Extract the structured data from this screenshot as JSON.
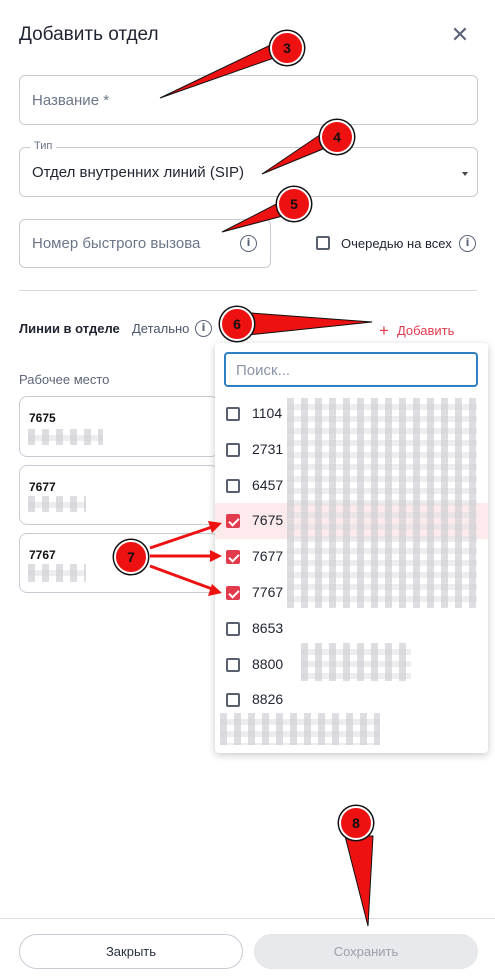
{
  "dialog": {
    "title": "Добавить отдел",
    "close_icon": "close-icon"
  },
  "form": {
    "name_placeholder": "Название *",
    "type_legend": "Тип",
    "type_value": "Отдел внутренних линий (SIP)",
    "speed_dial_placeholder": "Номер быстрого вызова",
    "queue_label": "Очередью на всех"
  },
  "lines": {
    "label": "Линии в отделе",
    "details": "Детально",
    "add": "Добавить",
    "workplace_label": "Рабочее место",
    "cards": [
      "7675",
      "7677",
      "7767"
    ]
  },
  "dropdown": {
    "search_placeholder": "Поиск...",
    "options": [
      {
        "label": "1104",
        "checked": false
      },
      {
        "label": "2731",
        "checked": false
      },
      {
        "label": "6457",
        "checked": false
      },
      {
        "label": "7675",
        "checked": true
      },
      {
        "label": "7677",
        "checked": true
      },
      {
        "label": "7767",
        "checked": true
      },
      {
        "label": "8653",
        "checked": false
      },
      {
        "label": "8800",
        "checked": false
      },
      {
        "label": "8826",
        "checked": false
      }
    ]
  },
  "footer": {
    "close_label": "Закрыть",
    "save_label": "Сохранить"
  },
  "annotations": [
    "3",
    "4",
    "5",
    "6",
    "7",
    "8"
  ],
  "colors": {
    "accent": "#e23b4e",
    "focus": "#2f80c3",
    "annotation": "#e11111"
  }
}
